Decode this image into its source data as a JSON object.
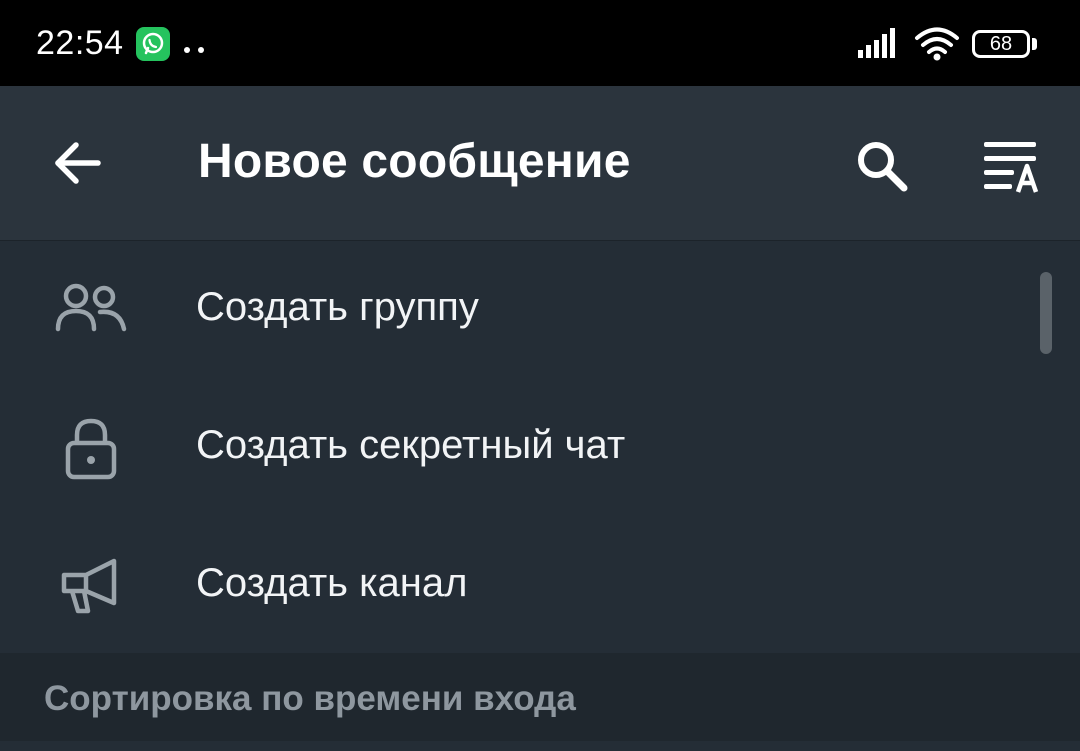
{
  "status_bar": {
    "time": "22:54",
    "battery": "68"
  },
  "app_bar": {
    "title": "Новое сообщение"
  },
  "menu": [
    {
      "label": "Создать группу",
      "icon": "group-icon"
    },
    {
      "label": "Создать секретный чат",
      "icon": "lock-icon"
    },
    {
      "label": "Создать канал",
      "icon": "megaphone-icon"
    }
  ],
  "section": {
    "label": "Сортировка по времени входа"
  },
  "colors": {
    "background": "#242d36",
    "app_bar": "#2b343d",
    "status_bar": "#000000",
    "section_bg": "#1f272e",
    "icon_gray": "#9aa3aa",
    "whatsapp_green": "#25c35e"
  }
}
